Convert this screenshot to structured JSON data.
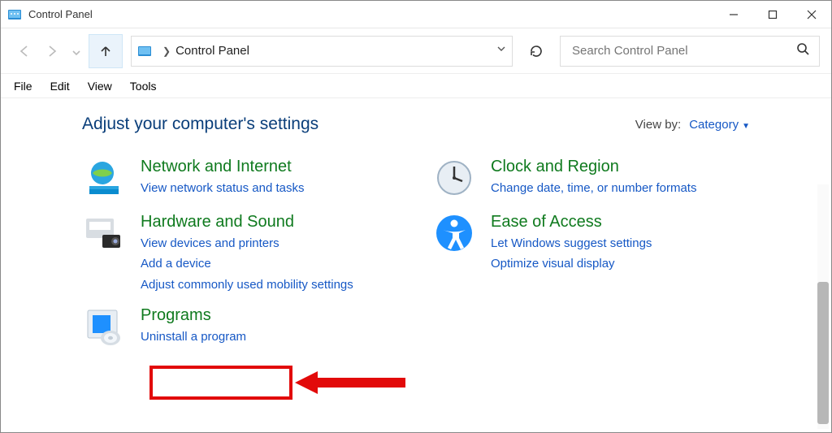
{
  "window": {
    "title": "Control Panel"
  },
  "breadcrumb": {
    "text": "Control Panel"
  },
  "search": {
    "placeholder": "Search Control Panel"
  },
  "menus": {
    "file": "File",
    "edit": "Edit",
    "view": "View",
    "tools": "Tools"
  },
  "heading": "Adjust your computer's settings",
  "viewby": {
    "label": "View by:",
    "value": "Category"
  },
  "categories": {
    "network": {
      "title": "Network and Internet",
      "links": [
        "View network status and tasks"
      ]
    },
    "hardware": {
      "title": "Hardware and Sound",
      "links": [
        "View devices and printers",
        "Add a device",
        "Adjust commonly used mobility settings"
      ]
    },
    "programs": {
      "title": "Programs",
      "links": [
        "Uninstall a program"
      ]
    },
    "clock": {
      "title": "Clock and Region",
      "links": [
        "Change date, time, or number formats"
      ]
    },
    "ease": {
      "title": "Ease of Access",
      "links": [
        "Let Windows suggest settings",
        "Optimize visual display"
      ]
    }
  }
}
